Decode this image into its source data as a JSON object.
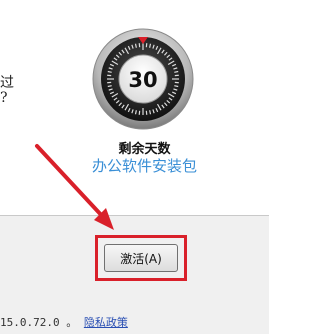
{
  "dialog": {
    "left_fragment_1": "过",
    "left_fragment_2": "?",
    "days_remaining_value": "30",
    "days_remaining_label": "剩余天数",
    "watermark": "办公软件安装包",
    "activate_button": "激活(A)",
    "version_text": "15.0.72.0",
    "privacy_link": "隐私政策"
  },
  "colors": {
    "annotation_red": "#d9202a",
    "watermark_blue": "#3a8fd6",
    "footer_bg": "#f0f0f0"
  }
}
